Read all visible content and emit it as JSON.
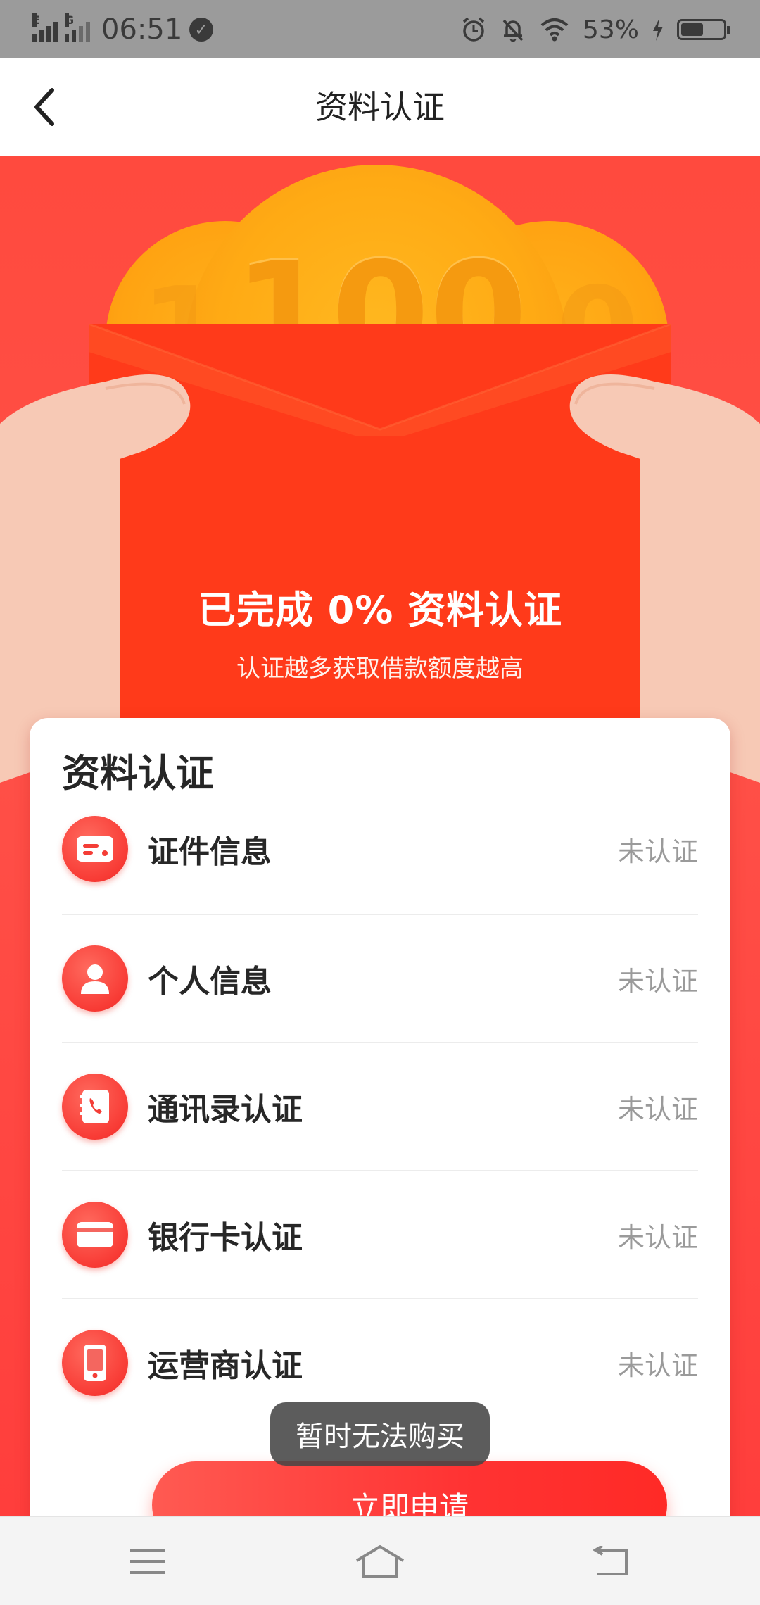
{
  "status_bar": {
    "signal_1_label": "E",
    "signal_2_label": "G",
    "time": "06:51",
    "battery_text": "53%",
    "battery_level": 0.53
  },
  "header": {
    "title": "资料认证",
    "back_icon": "chevron-left-icon"
  },
  "banner": {
    "title": "已完成 0% 资料认证",
    "subtitle": "认证越多获取借款额度越高",
    "coin_center": "100",
    "coin_left": "1",
    "coin_right": "0"
  },
  "card": {
    "title": "资料认证",
    "items": [
      {
        "label": "证件信息",
        "status": "未认证",
        "icon": "id-card-icon"
      },
      {
        "label": "个人信息",
        "status": "未认证",
        "icon": "person-icon"
      },
      {
        "label": "通讯录认证",
        "status": "未认证",
        "icon": "contacts-phone-icon"
      },
      {
        "label": "银行卡认证",
        "status": "未认证",
        "icon": "bank-card-icon"
      },
      {
        "label": "运营商认证",
        "status": "未认证",
        "icon": "mobile-phone-icon"
      }
    ],
    "apply_button": "立即申请"
  },
  "toast": {
    "text": "暂时无法购买"
  },
  "nav_bar": {
    "menu_icon": "menu-icon",
    "home_icon": "home-icon",
    "back_icon": "back-icon"
  },
  "colors": {
    "accent": "#ff4a3e",
    "envelope": "#ff3a1a",
    "coin": "#ffa312",
    "status_text": "#9a9a9a"
  }
}
